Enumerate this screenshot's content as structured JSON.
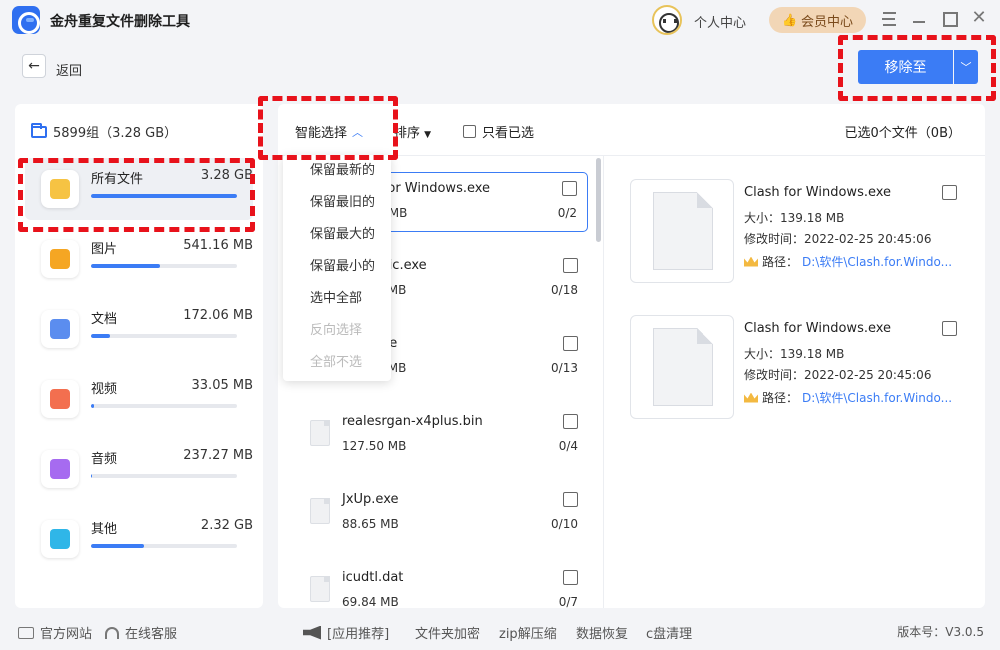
{
  "app": {
    "title": "金舟重复文件删除工具"
  },
  "header": {
    "personal_center": "个人中心",
    "vip_center": "会员中心"
  },
  "nav": {
    "back_label": "返回",
    "back_icon": "←"
  },
  "actions": {
    "move_to": "移除至"
  },
  "groups": {
    "summary": "5899组（3.28 GB）"
  },
  "categories": [
    {
      "name": "所有文件",
      "size": "3.28 GB",
      "ratio": 1.0,
      "icon": "folder-icon",
      "color": "#f6c343",
      "active": true
    },
    {
      "name": "图片",
      "size": "541.16 MB",
      "ratio": 0.47,
      "icon": "image-icon",
      "color": "#f5a623",
      "active": false
    },
    {
      "name": "文档",
      "size": "172.06 MB",
      "ratio": 0.13,
      "icon": "document-icon",
      "color": "#5b8def",
      "active": false
    },
    {
      "name": "视频",
      "size": "33.05 MB",
      "ratio": 0.02,
      "icon": "video-icon",
      "color": "#f36f4f",
      "active": false
    },
    {
      "name": "音频",
      "size": "237.27 MB",
      "ratio": 0.01,
      "icon": "music-icon",
      "color": "#a66bf0",
      "active": false
    },
    {
      "name": "其他",
      "size": "2.32 GB",
      "ratio": 0.36,
      "icon": "apps-icon",
      "color": "#2fb6e8",
      "active": false
    }
  ],
  "toolbar": {
    "smart_select": "智能选择",
    "sort": "排序",
    "only_selected": "只看已选",
    "selected_info": "已选0个文件（0B）"
  },
  "smart_menu": [
    {
      "label": "保留最新的",
      "disabled": false
    },
    {
      "label": "保留最旧的",
      "disabled": false
    },
    {
      "label": "保留最大的",
      "disabled": false
    },
    {
      "label": "保留最小的",
      "disabled": false
    },
    {
      "label": "选中全部",
      "disabled": false
    },
    {
      "label": "反向选择",
      "disabled": true
    },
    {
      "label": "全部不选",
      "disabled": true
    }
  ],
  "files": [
    {
      "name": "Clash for Windows.exe",
      "size": "139.18 MB",
      "count": "0/2",
      "active": true
    },
    {
      "name": "QQMusic.exe",
      "size": "139.18 MB",
      "count": "0/18",
      "active": false
    },
    {
      "name": "Lark.exe",
      "size": "139.18 MB",
      "count": "0/13",
      "active": false
    },
    {
      "name": "realesrgan-x4plus.bin",
      "size": "127.50 MB",
      "count": "0/4",
      "active": false
    },
    {
      "name": "JxUp.exe",
      "size": "88.65 MB",
      "count": "0/10",
      "active": false
    },
    {
      "name": "icudtl.dat",
      "size": "69.84 MB",
      "count": "0/7",
      "active": false
    }
  ],
  "details": [
    {
      "name": "Clash for Windows.exe",
      "size": "大小：139.18 MB",
      "modified": "修改时间：2022-02-25 20:45:06",
      "path_label": "路径：",
      "path": "D:\\软件\\Clash.for.Windo..."
    },
    {
      "name": "Clash for Windows.exe",
      "size": "大小：139.18 MB",
      "modified": "修改时间：2022-02-25 20:45:06",
      "path_label": "路径：",
      "path": "D:\\软件\\Clash.for.Windo..."
    }
  ],
  "footer": {
    "official_site": "官方网站",
    "online_service": "在线客服",
    "recommend": "[应用推荐]",
    "links": [
      "文件夹加密",
      "zip解压缩",
      "数据恢复",
      "c盘清理"
    ],
    "version": "版本号：V3.0.5"
  },
  "colors": {
    "accent": "#3b7cf5",
    "annotation": "#e8121b",
    "vip_bg": "#f2d6b6"
  }
}
